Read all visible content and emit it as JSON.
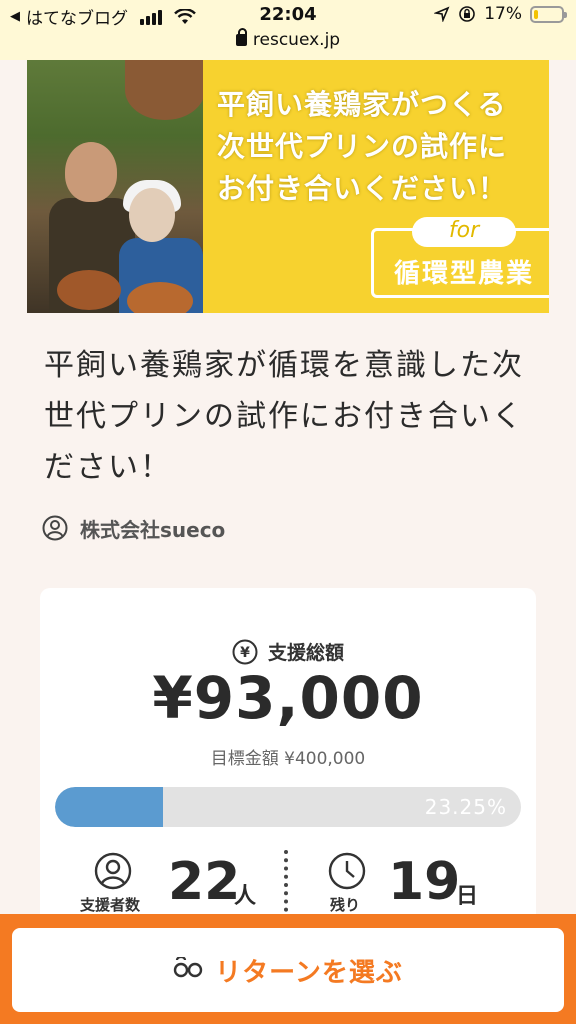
{
  "status_bar": {
    "back_app": "はてなブログ",
    "time": "22:04",
    "battery": "17%",
    "battery_level": 0.17,
    "url": "rescuex.jp"
  },
  "hero": {
    "line1": "平飼い養鶏家がつくる",
    "line2": "次世代プリンの試作に",
    "line3": "お付き合いください！",
    "badge_for": "for",
    "badge_text": "循環型農業"
  },
  "project": {
    "title": "平飼い養鶏家が循環を意識した次世代プリンの試作にお付き合いください！",
    "company": "株式会社sueco"
  },
  "funding": {
    "label": "支援総額",
    "amount": "¥93,000",
    "goal": "目標金額 ¥400,000",
    "progress_percent": 23.25,
    "progress_text": "23.25%",
    "supporters_label": "支援者数",
    "supporters_count": "22",
    "supporters_unit": "人",
    "remaining_label": "残り",
    "remaining_count": "19",
    "remaining_unit": "日"
  },
  "cta": {
    "label": "リターンを選ぶ"
  },
  "colors": {
    "accent_orange": "#f47a22",
    "progress_blue": "#5b9bd0",
    "hero_yellow": "#f7d22f"
  }
}
